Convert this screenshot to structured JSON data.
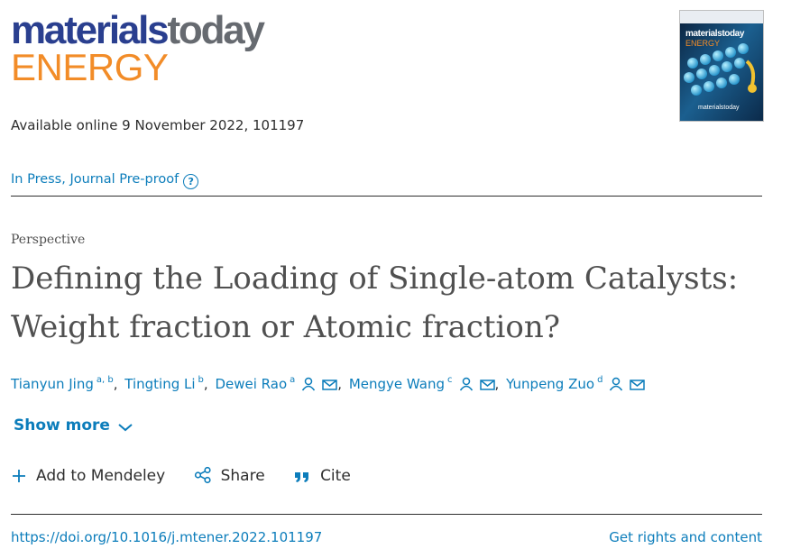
{
  "journal": {
    "logo_part1": "materials",
    "logo_part2": "today",
    "logo_energy": "ENERGY",
    "brand_colors": {
      "blue": "#2a3f8f",
      "gray": "#666a70",
      "orange": "#f28c28"
    }
  },
  "cover": {
    "title": "materialstoday",
    "subtitle": "ENERGY",
    "footer": "materialstoday",
    "icon": "journal-cover-image"
  },
  "available_online": "Available online 9 November 2022, 101197",
  "status": {
    "label": "In Press, Journal Pre-proof",
    "help_icon": "question-circle-icon",
    "help_glyph": "?"
  },
  "article": {
    "type": "Perspective",
    "title": "Defining the Loading of Single-atom Catalysts: Weight fraction or Atomic fraction?"
  },
  "authors": [
    {
      "name": "Tianyun Jing",
      "affil": "a, b",
      "separator": ",",
      "corresponding": false
    },
    {
      "name": "Tingting Li",
      "affil": "b",
      "separator": ",",
      "corresponding": false
    },
    {
      "name": "Dewei Rao",
      "affil": "a",
      "separator": ",",
      "corresponding": true
    },
    {
      "name": "Mengye Wang",
      "affil": "c",
      "separator": ",",
      "corresponding": true
    },
    {
      "name": "Yunpeng Zuo",
      "affil": "d",
      "separator": "",
      "corresponding": true
    }
  ],
  "show_more": "Show more",
  "actions": {
    "mendeley": "Add to Mendeley",
    "share": "Share",
    "cite": "Cite"
  },
  "doi": "https://doi.org/10.1016/j.mtener.2022.101197",
  "rights": "Get rights and content",
  "colors": {
    "link": "#0c7dbb",
    "text": "#2e2e2e",
    "title": "#505050"
  }
}
